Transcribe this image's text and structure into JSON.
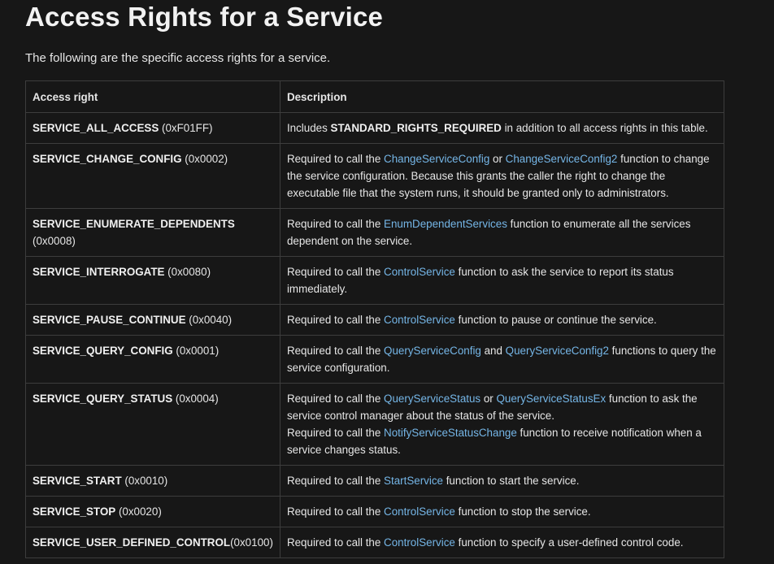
{
  "page": {
    "title": "Access Rights for a Service",
    "intro": "The following are the specific access rights for a service."
  },
  "table": {
    "headers": [
      "Access right",
      "Description"
    ],
    "rows": [
      {
        "right": "SERVICE_ALL_ACCESS",
        "value": " (0xF01FF)",
        "desc": [
          {
            "t": "Includes "
          },
          {
            "t": "STANDARD_RIGHTS_REQUIRED",
            "bold": true
          },
          {
            "t": " in addition to all access rights in this table."
          }
        ]
      },
      {
        "right": "SERVICE_CHANGE_CONFIG",
        "value": " (0x0002)",
        "desc": [
          {
            "t": "Required to call the "
          },
          {
            "t": "ChangeServiceConfig",
            "link": true
          },
          {
            "t": " or "
          },
          {
            "t": "ChangeServiceConfig2",
            "link": true
          },
          {
            "t": " function to change the service configuration. Because this grants the caller the right to change the executable file that the system runs, it should be granted only to administrators."
          }
        ]
      },
      {
        "right": "SERVICE_ENUMERATE_DEPENDENTS",
        "value": " (0x0008)",
        "desc": [
          {
            "t": "Required to call the "
          },
          {
            "t": "EnumDependentServices",
            "link": true
          },
          {
            "t": " function to enumerate all the services dependent on the service."
          }
        ]
      },
      {
        "right": "SERVICE_INTERROGATE",
        "value": " (0x0080)",
        "desc": [
          {
            "t": "Required to call the "
          },
          {
            "t": "ControlService",
            "link": true
          },
          {
            "t": " function to ask the service to report its status immediately."
          }
        ]
      },
      {
        "right": "SERVICE_PAUSE_CONTINUE",
        "value": " (0x0040)",
        "desc": [
          {
            "t": "Required to call the "
          },
          {
            "t": "ControlService",
            "link": true
          },
          {
            "t": " function to pause or continue the service."
          }
        ]
      },
      {
        "right": "SERVICE_QUERY_CONFIG",
        "value": " (0x0001)",
        "desc": [
          {
            "t": "Required to call the "
          },
          {
            "t": "QueryServiceConfig",
            "link": true
          },
          {
            "t": " and "
          },
          {
            "t": "QueryServiceConfig2",
            "link": true
          },
          {
            "t": " functions to query the service configuration."
          }
        ]
      },
      {
        "right": "SERVICE_QUERY_STATUS",
        "value": " (0x0004)",
        "desc": [
          {
            "t": "Required to call the "
          },
          {
            "t": "QueryServiceStatus",
            "link": true
          },
          {
            "t": " or "
          },
          {
            "t": "QueryServiceStatusEx",
            "link": true
          },
          {
            "t": " function to ask the service control manager about the status of the service."
          },
          {
            "br": true
          },
          {
            "t": "Required to call the "
          },
          {
            "t": "NotifyServiceStatusChange",
            "link": true
          },
          {
            "t": " function to receive notification when a service changes status."
          }
        ]
      },
      {
        "right": "SERVICE_START",
        "value": " (0x0010)",
        "desc": [
          {
            "t": "Required to call the "
          },
          {
            "t": "StartService",
            "link": true
          },
          {
            "t": " function to start the service."
          }
        ]
      },
      {
        "right": "SERVICE_STOP",
        "value": " (0x0020)",
        "desc": [
          {
            "t": "Required to call the "
          },
          {
            "t": "ControlService",
            "link": true
          },
          {
            "t": " function to stop the service."
          }
        ]
      },
      {
        "right": "SERVICE_USER_DEFINED_CONTROL",
        "value": "(0x0100)",
        "desc": [
          {
            "t": "Required to call the "
          },
          {
            "t": "ControlService",
            "link": true
          },
          {
            "t": " function to specify a user-defined control code."
          }
        ]
      }
    ]
  }
}
